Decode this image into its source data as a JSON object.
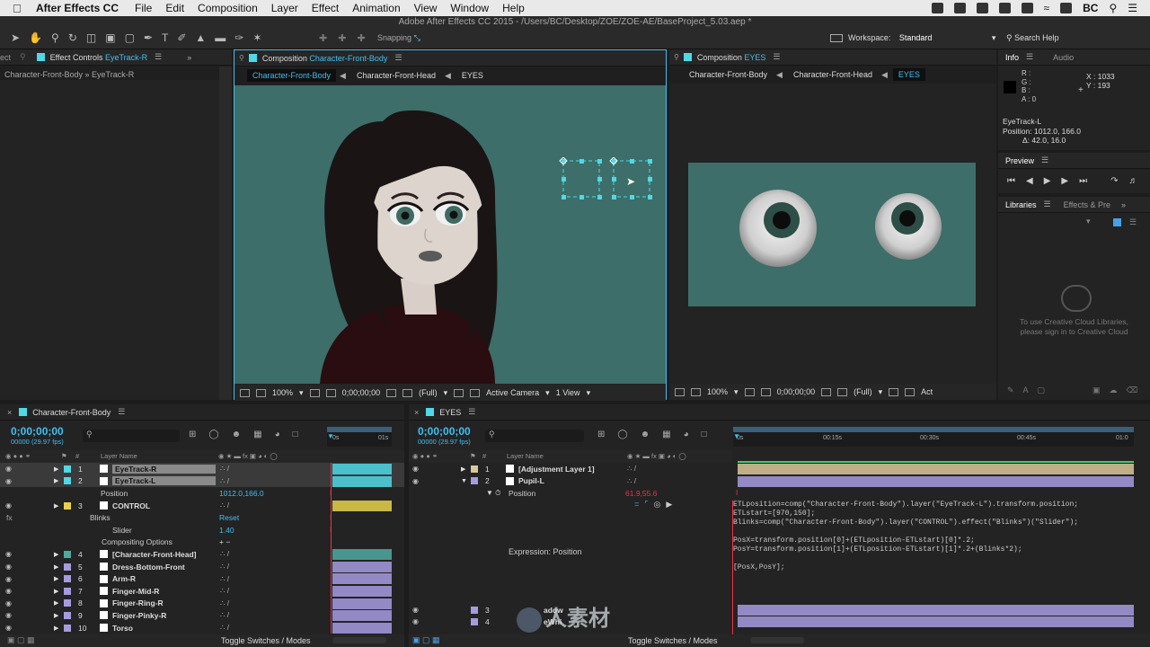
{
  "menubar": {
    "app": "After Effects CC",
    "items": [
      "File",
      "Edit",
      "Composition",
      "Layer",
      "Effect",
      "Animation",
      "View",
      "Window",
      "Help"
    ],
    "user": "BC"
  },
  "window_title": "Adobe After Effects CC 2015 - /Users/BC/Desktop/ZOE/ZOE-AE/BaseProject_5.03.aep *",
  "toolbar": {
    "snapping": "Snapping",
    "workspace_label": "Workspace:",
    "workspace_value": "Standard",
    "search_help": "Search Help"
  },
  "effect_controls": {
    "tab_partial": "ect",
    "tab_label": "Effect Controls",
    "tab_layer": "EyeTrack-R",
    "breadcrumb": "Character-Front-Body » EyeTrack-R"
  },
  "comp_left": {
    "tab_label": "Composition",
    "tab_comp": "Character-Front-Body",
    "crumbs": [
      "Character-Front-Body",
      "Character-Front-Head",
      "EYES"
    ],
    "zoom": "100%",
    "time": "0;00;00;00",
    "resolution": "(Full)",
    "camera": "Active Camera",
    "views": "1 View"
  },
  "comp_right": {
    "tab_label": "Composition",
    "tab_comp": "EYES",
    "crumbs": [
      "Character-Front-Body",
      "Character-Front-Head",
      "EYES"
    ],
    "zoom": "100%",
    "time": "0;00;00;00",
    "resolution": "(Full)",
    "camera_partial": "Act"
  },
  "info": {
    "tabs": [
      "Info",
      "Audio"
    ],
    "r": "R :",
    "g": "G :",
    "b": "B :",
    "a": "A : 0",
    "x": "X : 1033",
    "y": "Y : 193",
    "layer": "EyeTrack-L",
    "position": "Position: 1012.0, 166.0",
    "delta": "Δ: 42.0, 16.0"
  },
  "preview": {
    "tab": "Preview"
  },
  "libraries": {
    "tabs": [
      "Libraries",
      "Effects & Pre"
    ],
    "message_line1": "To use Creative Cloud Libraries,",
    "message_line2": "please sign in to Creative Cloud"
  },
  "timeline_left": {
    "tab": "Character-Front-Body",
    "timecode": "0;00;00;00",
    "fps": "00000 (29.97 fps)",
    "col_layer_name": "Layer Name",
    "ruler_marks": [
      "0s",
      "01s"
    ],
    "footer": "Toggle Switches / Modes",
    "layers": [
      {
        "num": "1",
        "name": "EyeTrack-R",
        "color": "#4fd8e6",
        "selected": true
      },
      {
        "num": "2",
        "name": "EyeTrack-L",
        "color": "#4fd8e6",
        "selected": true
      },
      {
        "num": "",
        "name": "Position",
        "value": "1012.0,166.0",
        "prop": true
      },
      {
        "num": "3",
        "name": "CONTROL",
        "color": "#e6d24a"
      },
      {
        "num": "",
        "name": "Blinks",
        "value": "Reset",
        "prop": true
      },
      {
        "num": "",
        "name": "Slider",
        "value": "1.40",
        "prop": true
      },
      {
        "num": "",
        "name": "Compositing Options",
        "value": "+ −",
        "prop": true
      },
      {
        "num": "4",
        "name": "[Character-Front-Head]",
        "color": "#4faaa0"
      },
      {
        "num": "5",
        "name": "Dress-Bottom-Front",
        "color": "#a79be0"
      },
      {
        "num": "6",
        "name": "Arm-R",
        "color": "#a79be0"
      },
      {
        "num": "7",
        "name": "Finger-Mid-R",
        "color": "#a79be0"
      },
      {
        "num": "8",
        "name": "Finger-Ring-R",
        "color": "#a79be0"
      },
      {
        "num": "9",
        "name": "Finger-Pinky-R",
        "color": "#a79be0"
      },
      {
        "num": "10",
        "name": "Torso",
        "color": "#a79be0"
      }
    ]
  },
  "timeline_right": {
    "tab": "EYES",
    "timecode": "0;00;00;00",
    "fps": "00000 (29.97 fps)",
    "col_layer_name": "Layer Name",
    "ruler_marks": [
      "0s",
      "00:15s",
      "00:30s",
      "00:45s",
      "01:0"
    ],
    "footer": "Toggle Switches / Modes",
    "layers": [
      {
        "num": "1",
        "name": "[Adjustment Layer 1]",
        "color": "#d9c89a"
      },
      {
        "num": "2",
        "name": "Pupil-L",
        "color": "#a79be0"
      },
      {
        "num": "",
        "name": "Position",
        "value": "61.9,55.6",
        "prop": true
      }
    ],
    "hidden_layers": [
      {
        "num": "3",
        "name": "adow"
      },
      {
        "num": "4",
        "name": "eWhi"
      }
    ],
    "expression_label": "Expression: Position",
    "expression": "ETLposition=comp(\"Character-Front-Body\").layer(\"EyeTrack-L\").transform.position;\nETLstart=[970,150];\nBlinks=comp(\"Character-Front-Body\").layer(\"CONTROL\").effect(\"Blinks\")(\"Slider\");\n\nPosX=transform.position[0]+(ETLposition-ETLstart)[0]*.2;\nPosY=transform.position[1]+(ETLposition-ETLstart)[1]*.2+(Blinks*2);\n\n[PosX,PosY];"
  },
  "watermark": "人素材",
  "colors": {
    "accent": "#41bff0",
    "comp_bg": "#3d6e69",
    "selection": "#4fd8e6"
  }
}
